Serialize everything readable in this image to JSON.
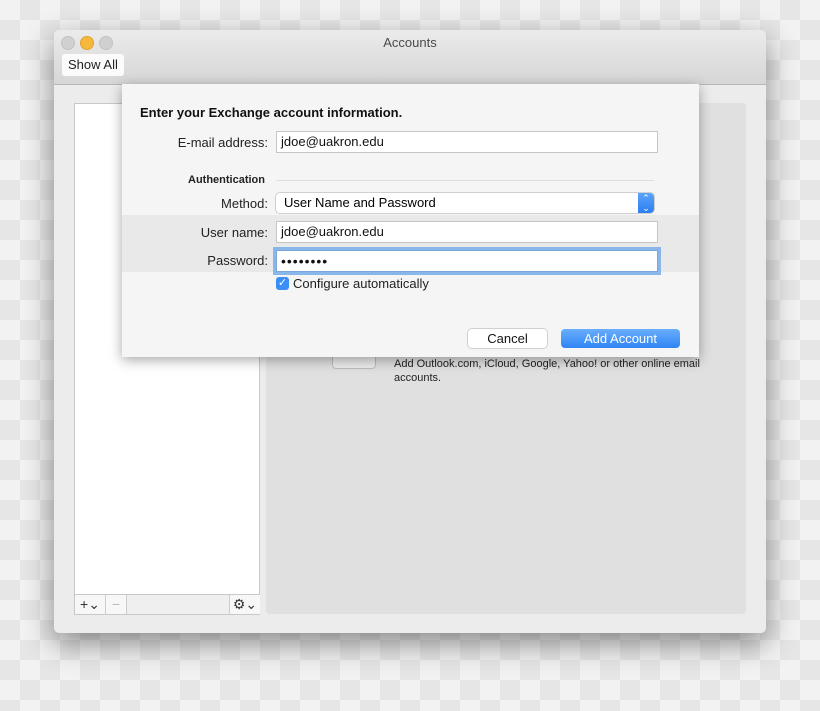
{
  "window": {
    "title": "Accounts",
    "show_all": "Show All"
  },
  "sidebar": {
    "add": "+⌄",
    "remove": "−",
    "gear": "⚙⌄"
  },
  "right_pane": {
    "description": "Add Outlook.com, iCloud, Google, Yahoo! or other online email accounts."
  },
  "sheet": {
    "title": "Enter your Exchange account information.",
    "email_label": "E-mail address:",
    "email_value": "jdoe@uakron.edu",
    "auth_header": "Authentication",
    "method_label": "Method:",
    "method_value": "User Name and Password",
    "username_label": "User name:",
    "username_value": "jdoe@uakron.edu",
    "password_label": "Password:",
    "password_value": "••••••••",
    "configure_label": "Configure automatically",
    "configure_checked": true,
    "cancel": "Cancel",
    "add_account": "Add Account"
  },
  "colors": {
    "accent": "#2f84f4",
    "close": "#d0d0d0",
    "minimize": "#f6b93c"
  }
}
